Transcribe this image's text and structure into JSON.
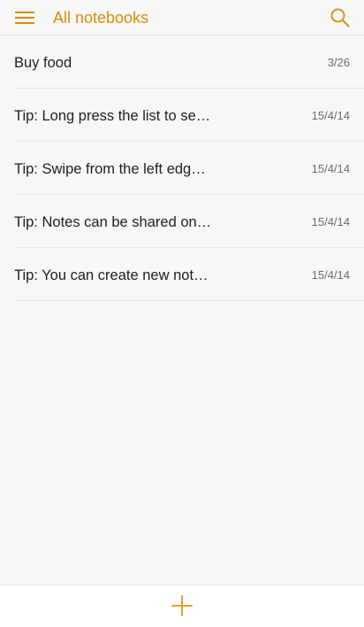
{
  "header": {
    "title": "All notebooks",
    "menu_icon": "hamburger-menu-icon",
    "search_icon": "search-icon"
  },
  "notes": [
    {
      "title": "Buy food",
      "date": "3/26"
    },
    {
      "title": "Tip: Long press the list to se…",
      "date": "15/4/14"
    },
    {
      "title": "Tip: Swipe from the left edg…",
      "date": "15/4/14"
    },
    {
      "title": "Tip: Notes can be shared on…",
      "date": "15/4/14"
    },
    {
      "title": "Tip: You can create new not…",
      "date": "15/4/14"
    }
  ],
  "bottom_bar": {
    "add_icon": "plus-icon"
  },
  "colors": {
    "accent": "#d98c0b",
    "background": "#f7f7f8",
    "text": "#1f1f1f",
    "secondary_text": "#6c6c6c"
  }
}
